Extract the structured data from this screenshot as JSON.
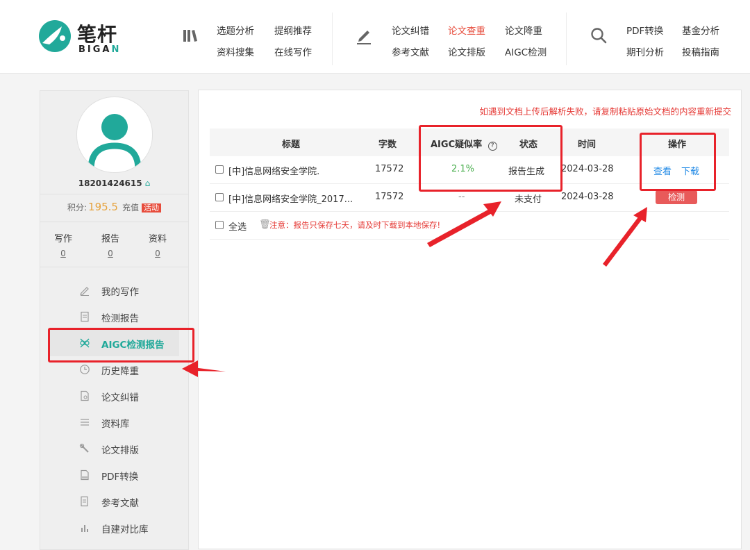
{
  "logo": {
    "cn": "笔杆",
    "en_prefix": "BIGA",
    "en_suffix": "N",
    "icon": "bigan-logo-icon"
  },
  "nav": {
    "group1": {
      "icon": "books-icon",
      "links": [
        "选题分析",
        "提纲推荐",
        "资料搜集",
        "在线写作"
      ]
    },
    "group2": {
      "icon": "pen-icon",
      "links": [
        "论文纠错",
        "论文查重",
        "论文降重",
        "参考文献",
        "论文排版",
        "AIGC检测"
      ],
      "active": "论文查重"
    },
    "group3": {
      "icon": "search-icon",
      "links": [
        "PDF转换",
        "基金分析",
        "期刊分析",
        "投稿指南"
      ]
    }
  },
  "sidebar": {
    "phone": "18201424615",
    "bank_icon": "bank-icon",
    "points_label": "积分:",
    "points_value": "195.5",
    "recharge": "充值",
    "promo_badge": "活动",
    "stats": [
      {
        "label": "写作",
        "count": "0"
      },
      {
        "label": "报告",
        "count": "0"
      },
      {
        "label": "资料",
        "count": "0"
      }
    ],
    "menu": [
      {
        "label": "我的写作",
        "icon": "pencil-icon"
      },
      {
        "label": "检测报告",
        "icon": "document-icon"
      },
      {
        "label": "AIGC检测报告",
        "icon": "aigc-icon",
        "active": true
      },
      {
        "label": "历史降重",
        "icon": "clock-icon"
      },
      {
        "label": "论文纠错",
        "icon": "doc-check-icon"
      },
      {
        "label": "资料库",
        "icon": "list-icon"
      },
      {
        "label": "论文排版",
        "icon": "wrench-icon"
      },
      {
        "label": "PDF转换",
        "icon": "pdf-icon"
      },
      {
        "label": "参考文献",
        "icon": "reference-icon"
      },
      {
        "label": "自建对比库",
        "icon": "bar-chart-icon"
      }
    ]
  },
  "main": {
    "notice": "如遇到文档上传后解析失败，请复制粘贴原始文档的内容重新提交",
    "headers": {
      "title": "标题",
      "words": "字数",
      "rate": "AIGC疑似率",
      "status": "状态",
      "time": "时间",
      "ops": "操作"
    },
    "rows": [
      {
        "title": "[中]信息网络安全学院.",
        "words": "17572",
        "rate": "2.1%",
        "status": "报告生成",
        "time": "2024-03-28",
        "view": "查看",
        "download": "下载"
      },
      {
        "title": "[中]信息网络安全学院_2017...",
        "words": "17572",
        "rate": "--",
        "status": "未支付",
        "time": "2024-03-28",
        "detect": "检测"
      }
    ],
    "select_all": "全选",
    "warning": "注意：报告只保存七天，请及时下载到本地保存!"
  },
  "colors": {
    "accent": "#21a99a",
    "active_nav": "#e74c3c",
    "annotation_red": "#e8222a",
    "link_blue": "#1e88e5"
  }
}
